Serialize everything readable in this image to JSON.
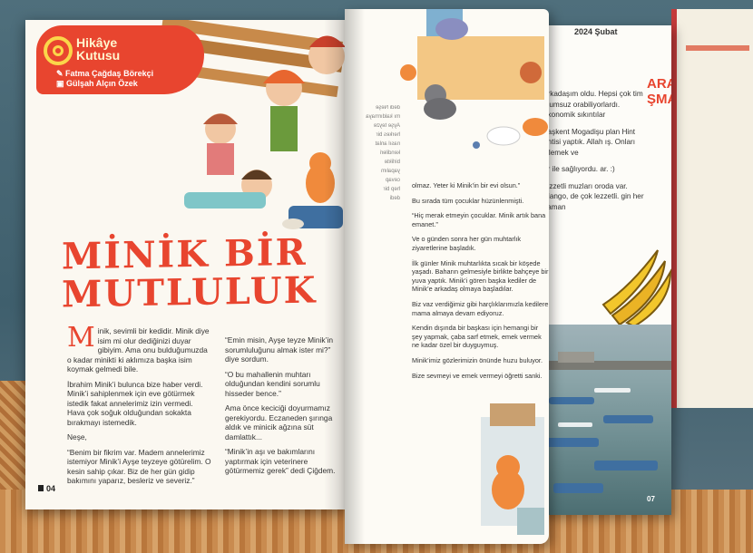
{
  "left_page": {
    "series_title": "Hikâye Kutusu",
    "author": "Fatma Çağdaş Börekçi",
    "illustrator": "Gülşah Alçın Özek",
    "headline_line1": "MİNİK BİR",
    "headline_line2": "MUTLULUK",
    "col1": {
      "dropcap": "M",
      "p1": "inik, sevimli bir kedidir. Minik diye isim mi olur dediğinizi duyar gibiyim. Ama onu bulduğumuzda o kadar minikti ki aklımıza başka isim koymak gelmedi bile.",
      "p2": "İbrahim Minik’i bulunca bize haber verdi. Minik’i sahiplenmek için eve götürmek istedik fakat annelerimiz izin vermedi. Hava çok soğuk olduğundan sokakta bırakmayı istemedik.",
      "p3": "Neşe,",
      "p4": "“Benim bir fikrim var. Madem annelerimiz istemiyor Minik’i Ayşe teyzeye götürelim. O kesin sahip çıkar. Biz de her gün gidip bakımını yaparız, besleriz ve severiz.”"
    },
    "col2": {
      "p1": "“Emin misin, Ayşe teyze Minik’in sorumluluğunu almak ister mi?” diye sordum.",
      "p2": "“O bu mahallenin muhtarı olduğundan kendini sorumlu hisseder bence.”",
      "p3": "Ama önce keciciği doyurmamız gerekiyordu. Eczaneden şırınga aldık ve minicik ağzına süt damlattık...",
      "p4": "“Minik’in aşı ve bakımlarını yaptırmak için veterinere götürmemiz gerek” dedi Çiğdem."
    },
    "page_number": "04"
  },
  "right_page": {
    "mirror_lines": [
      "dedi Neşe",
      "mı kaldırmaya",
      "Ayşe teyze",
      "herkes bir",
      "nasıl anlat",
      "kendileri",
      "birlikte",
      "yapalım",
      "cevap",
      "hep bir",
      "dedi"
    ],
    "p1": "olmaz. Yeter ki Minik’in bir evi olsun.”",
    "p2": "Bu sırada tüm çocuklar hüzünlenmişti.",
    "p3": "“Hiç merak etmeyin çocuklar. Minik artık bana emanet.”",
    "p4": "Ve o günden sonra her gün muhtarlık ziyaretlerine başladık.",
    "p5": "İlk günler Minik muhtarlıkta sıcak bir köşede yaşadı. Baharın gelmesiyle birlikte bahçeye bir yuva yaptık. Minik’i gören başka kediler de Minik’e arkadaş olmaya başladılar.",
    "p6": "Biz vaz verdiğimiz gibi harçlıklarımızla kedilere mama almaya devam ediyoruz.",
    "p7": "Kendin dışında bir başkası için hemangi bir şey yapmak, çaba sarf etmek, emek vermek ne kadar özel bir duyguymuş.",
    "p8": "Minik’imiz gözlerimizin önünde huzu buluyor.",
    "p9": "Bize sevmeyi ve emek vermeyi öğretti sanki."
  },
  "third_page": {
    "date": "2024 Şubat",
    "heading_line1": "ARASI",
    "heading_line2": "ŞMA",
    "p1": "arkadaşım oldu. Hepsi çok tim olumsuz orabiliyorlardı. ekonomik sıkıntılar",
    "p2": "başkent Mogadişu plan Hint entisi yaptık. Allah ış. Onları izlemek ve",
    "p3": "ar ile sağlıyordu. ar. :)",
    "p4": "lezzetli muzları oroda var. Mango, de çok lezzetli. gin her zaman",
    "page_number": "07"
  },
  "colors": {
    "accent": "#e8452f",
    "badge_text": "#fff6cf",
    "logo": "#fbd64a"
  }
}
